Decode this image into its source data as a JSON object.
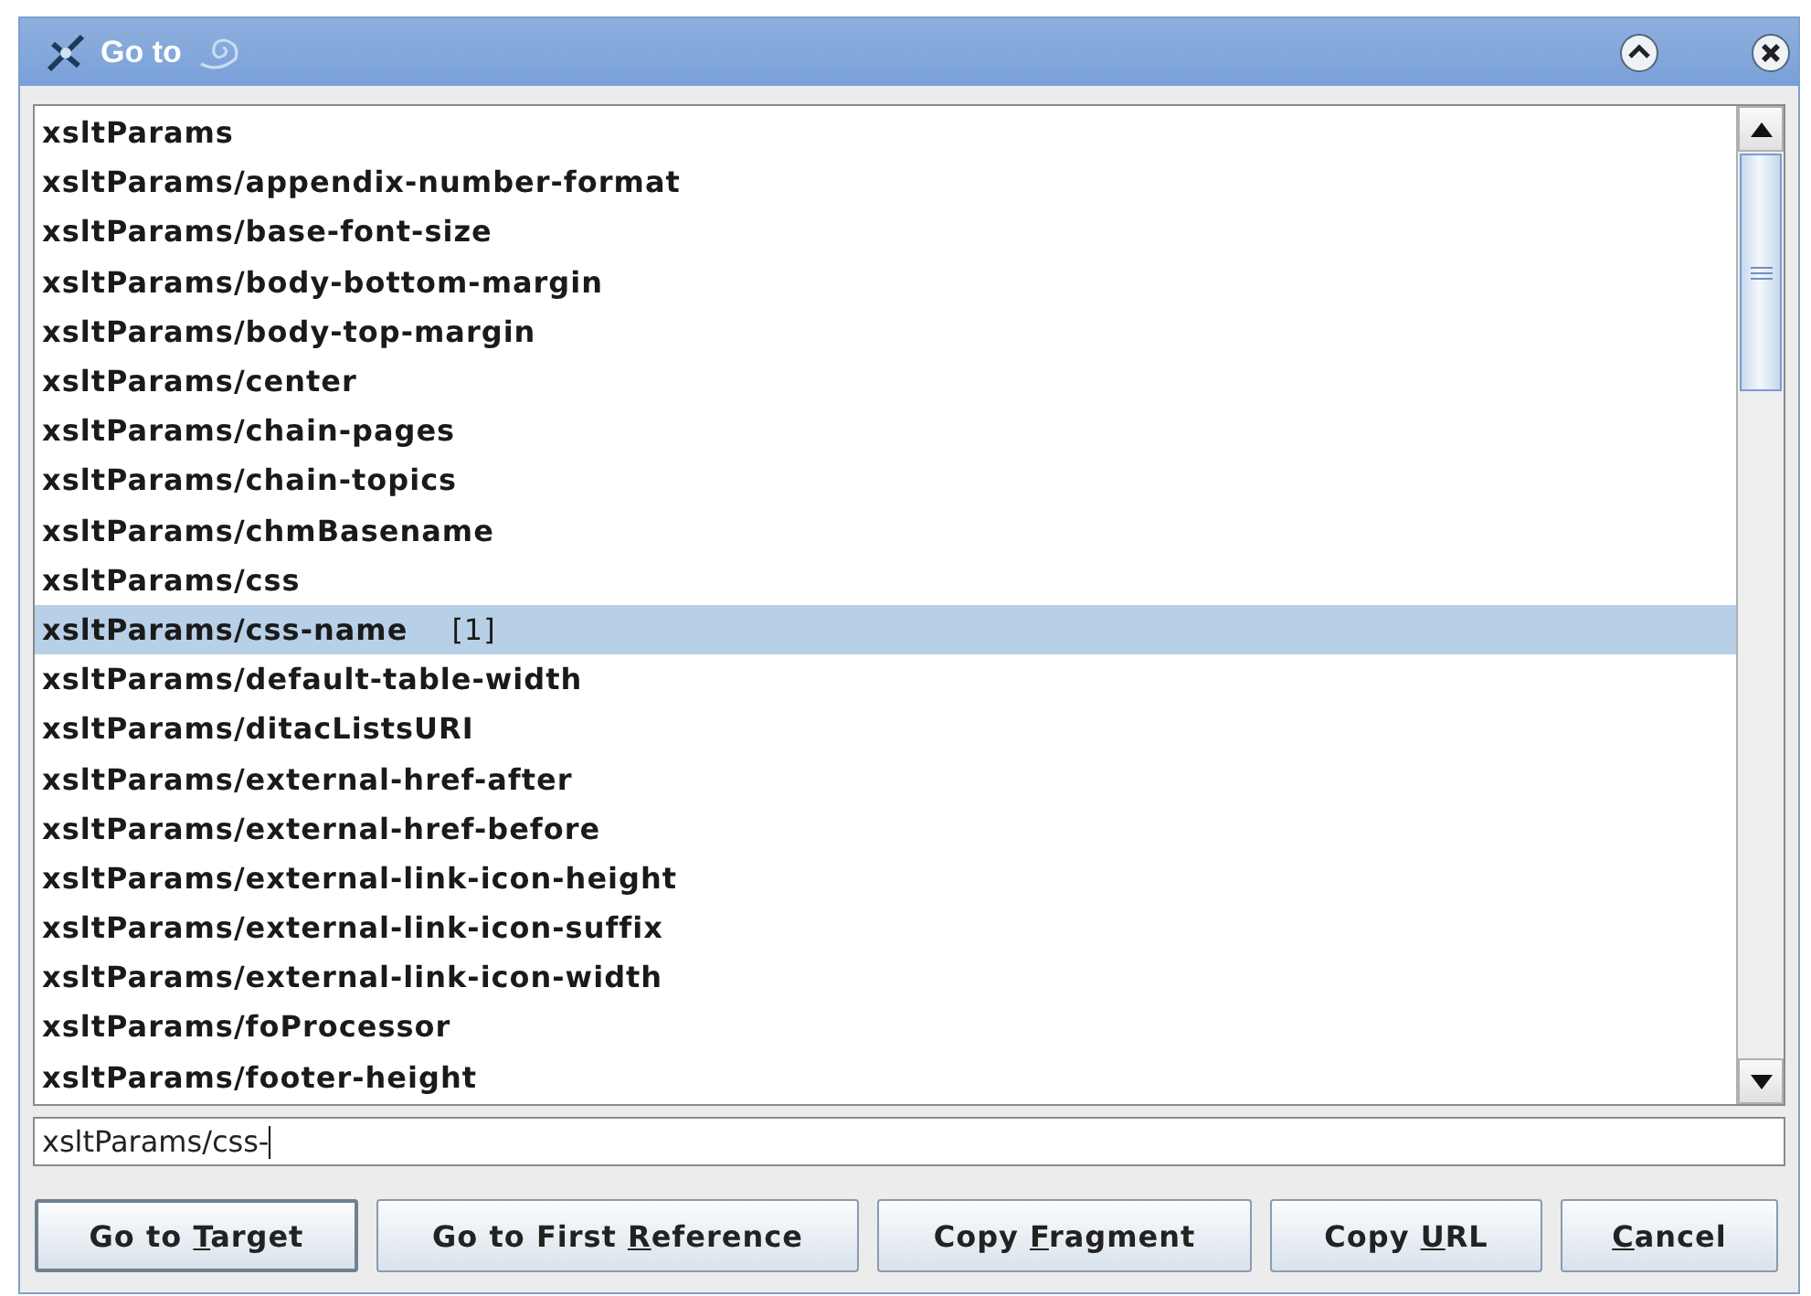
{
  "window": {
    "title": "Go to"
  },
  "list": {
    "items": [
      {
        "text": "xsltParams",
        "selected": false
      },
      {
        "text": "xsltParams/appendix-number-format",
        "selected": false
      },
      {
        "text": "xsltParams/base-font-size",
        "selected": false
      },
      {
        "text": "xsltParams/body-bottom-margin",
        "selected": false
      },
      {
        "text": "xsltParams/body-top-margin",
        "selected": false
      },
      {
        "text": "xsltParams/center",
        "selected": false
      },
      {
        "text": "xsltParams/chain-pages",
        "selected": false
      },
      {
        "text": "xsltParams/chain-topics",
        "selected": false
      },
      {
        "text": "xsltParams/chmBasename",
        "selected": false
      },
      {
        "text": "xsltParams/css",
        "selected": false
      },
      {
        "text": "xsltParams/css-name",
        "count": "[1]",
        "selected": true
      },
      {
        "text": "xsltParams/default-table-width",
        "selected": false
      },
      {
        "text": "xsltParams/ditacListsURI",
        "selected": false
      },
      {
        "text": "xsltParams/external-href-after",
        "selected": false
      },
      {
        "text": "xsltParams/external-href-before",
        "selected": false
      },
      {
        "text": "xsltParams/external-link-icon-height",
        "selected": false
      },
      {
        "text": "xsltParams/external-link-icon-suffix",
        "selected": false
      },
      {
        "text": "xsltParams/external-link-icon-width",
        "selected": false
      },
      {
        "text": "xsltParams/foProcessor",
        "selected": false
      },
      {
        "text": "xsltParams/footer-height",
        "selected": false
      }
    ]
  },
  "input": {
    "value": "xsltParams/css-"
  },
  "buttons": [
    {
      "before": "Go to ",
      "mnemonic": "T",
      "after": "arget",
      "default": true
    },
    {
      "before": "Go to First ",
      "mnemonic": "R",
      "after": "eference",
      "default": false
    },
    {
      "before": "Copy ",
      "mnemonic": "F",
      "after": "ragment",
      "default": false
    },
    {
      "before": "Copy ",
      "mnemonic": "U",
      "after": "RL",
      "default": false
    },
    {
      "mnemonic": "C",
      "after": "ancel",
      "default": false
    }
  ]
}
